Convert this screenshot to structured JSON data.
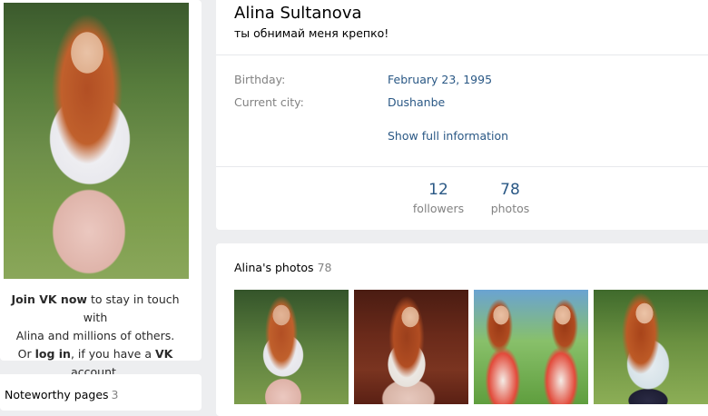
{
  "left": {
    "join_bold": "Join VK now",
    "join_rest_1": " to stay in touch with",
    "join_line2": "Alina and millions of others.",
    "or_text": "Or ",
    "login": "log in",
    "if_text": ", if you have a ",
    "vk": "VK",
    "account": " account."
  },
  "noteworthy": {
    "label": "Noteworthy pages",
    "count": "3"
  },
  "profile": {
    "name": "Alina Sultanova",
    "status": "ты обнимай меня крепко!",
    "birthday_label": "Birthday:",
    "birthday_value": "February 23, 1995",
    "city_label": "Current city:",
    "city_value": "Dushanbe",
    "show_full": "Show full information",
    "followers_count": "12",
    "followers_label": "followers",
    "photos_count": "78",
    "photos_label": "photos"
  },
  "photos": {
    "title": "Alina's photos",
    "count": "78"
  },
  "colors": {
    "link": "#2a5885",
    "muted": "#828282",
    "background": "#edeef0"
  }
}
